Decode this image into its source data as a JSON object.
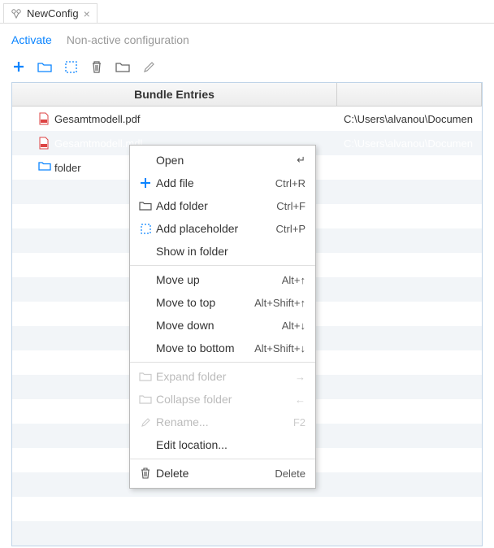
{
  "tab": {
    "title": "NewConfig"
  },
  "actions": {
    "activate": "Activate",
    "nonactive": "Non-active configuration"
  },
  "table": {
    "header1": "Bundle Entries",
    "header2": "",
    "rows": [
      {
        "name": "Gesamtmodell.pdf",
        "path": "C:\\Users\\alvanou\\Documen",
        "type": "pdf",
        "selected": false
      },
      {
        "name": "Gesamtmodell.mdl",
        "path": "C:\\Users\\alvanou\\Documen",
        "type": "mdl",
        "selected": true
      },
      {
        "name": "folder",
        "path": "",
        "type": "folder",
        "selected": false
      }
    ]
  },
  "contextMenu": {
    "items": [
      {
        "icon": "",
        "label": "Open",
        "shortcut": "↵",
        "disabled": false
      },
      {
        "icon": "plus",
        "label": "Add file",
        "shortcut": "Ctrl+R",
        "disabled": false
      },
      {
        "icon": "folder-open",
        "label": "Add folder",
        "shortcut": "Ctrl+F",
        "disabled": false
      },
      {
        "icon": "placeholder",
        "label": "Add placeholder",
        "shortcut": "Ctrl+P",
        "disabled": false
      },
      {
        "icon": "",
        "label": "Show in folder",
        "shortcut": "",
        "disabled": false
      },
      {
        "sep": true
      },
      {
        "icon": "",
        "label": "Move up",
        "shortcut": "Alt+↑",
        "disabled": false
      },
      {
        "icon": "",
        "label": "Move to top",
        "shortcut": "Alt+Shift+↑",
        "disabled": false
      },
      {
        "icon": "",
        "label": "Move down",
        "shortcut": "Alt+↓",
        "disabled": false
      },
      {
        "icon": "",
        "label": "Move to bottom",
        "shortcut": "Alt+Shift+↓",
        "disabled": false
      },
      {
        "sep": true
      },
      {
        "icon": "folder-open",
        "label": "Expand folder",
        "shortcut": "→",
        "disabled": true
      },
      {
        "icon": "folder",
        "label": "Collapse folder",
        "shortcut": "←",
        "disabled": true
      },
      {
        "icon": "pencil",
        "label": "Rename...",
        "shortcut": "F2",
        "disabled": true
      },
      {
        "icon": "",
        "label": "Edit location...",
        "shortcut": "",
        "disabled": false
      },
      {
        "sep": true
      },
      {
        "icon": "trash",
        "label": "Delete",
        "shortcut": "Delete",
        "disabled": false
      }
    ]
  }
}
